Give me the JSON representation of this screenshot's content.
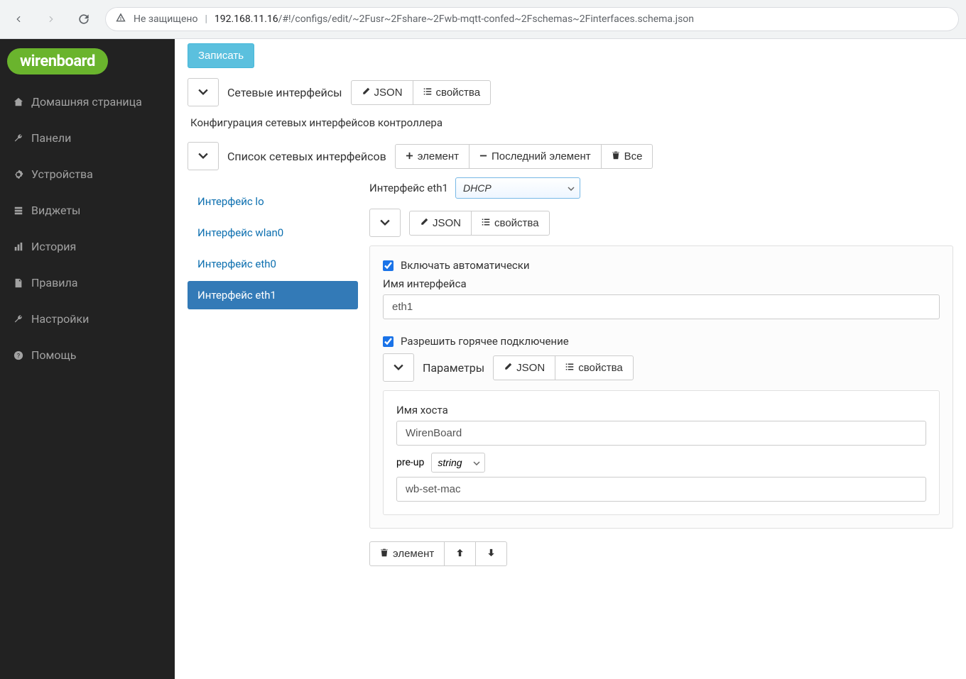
{
  "browser": {
    "insecure_label": "Не защищено",
    "url_host": "192.168.11.16",
    "url_rest": "/#!/configs/edit/~2Fusr~2Fshare~2Fwb-mqtt-confed~2Fschemas~2Finterfaces.schema.json"
  },
  "logo": "wirenboard",
  "sidebar": {
    "items": [
      {
        "label": "Домашняя страница"
      },
      {
        "label": "Панели"
      },
      {
        "label": "Устройства"
      },
      {
        "label": "Виджеты"
      },
      {
        "label": "История"
      },
      {
        "label": "Правила"
      },
      {
        "label": "Настройки"
      },
      {
        "label": "Помощь"
      }
    ]
  },
  "main": {
    "save_btn": "Записать",
    "net_section_title": "Сетевые интерфейсы",
    "json_btn": "JSON",
    "props_btn": "свойства",
    "desc": "Конфигурация сетевых интерфейсов контроллера",
    "list_title": "Список сетевых интерфейсов",
    "add_element": "элемент",
    "last_element": "Последний элемент",
    "all_label": "Все",
    "interfaces": [
      {
        "label": "Интерфейс lo"
      },
      {
        "label": "Интерфейс wlan0"
      },
      {
        "label": "Интерфейс eth0"
      },
      {
        "label": "Интерфейс eth1"
      }
    ],
    "detail": {
      "title": "Интерфейс eth1",
      "mode_value": "DHCP",
      "auto_label": "Включать автоматически",
      "auto_checked": true,
      "iface_name_label": "Имя интерфейса",
      "iface_name_value": "eth1",
      "hotplug_label": "Разрешить горячее подключение",
      "hotplug_checked": true,
      "params_title": "Параметры",
      "hostname_label": "Имя хоста",
      "hostname_value": "WirenBoard",
      "preup_label": "pre-up",
      "preup_type": "string",
      "preup_value": "wb-set-mac",
      "bottom_element": "элемент"
    }
  }
}
